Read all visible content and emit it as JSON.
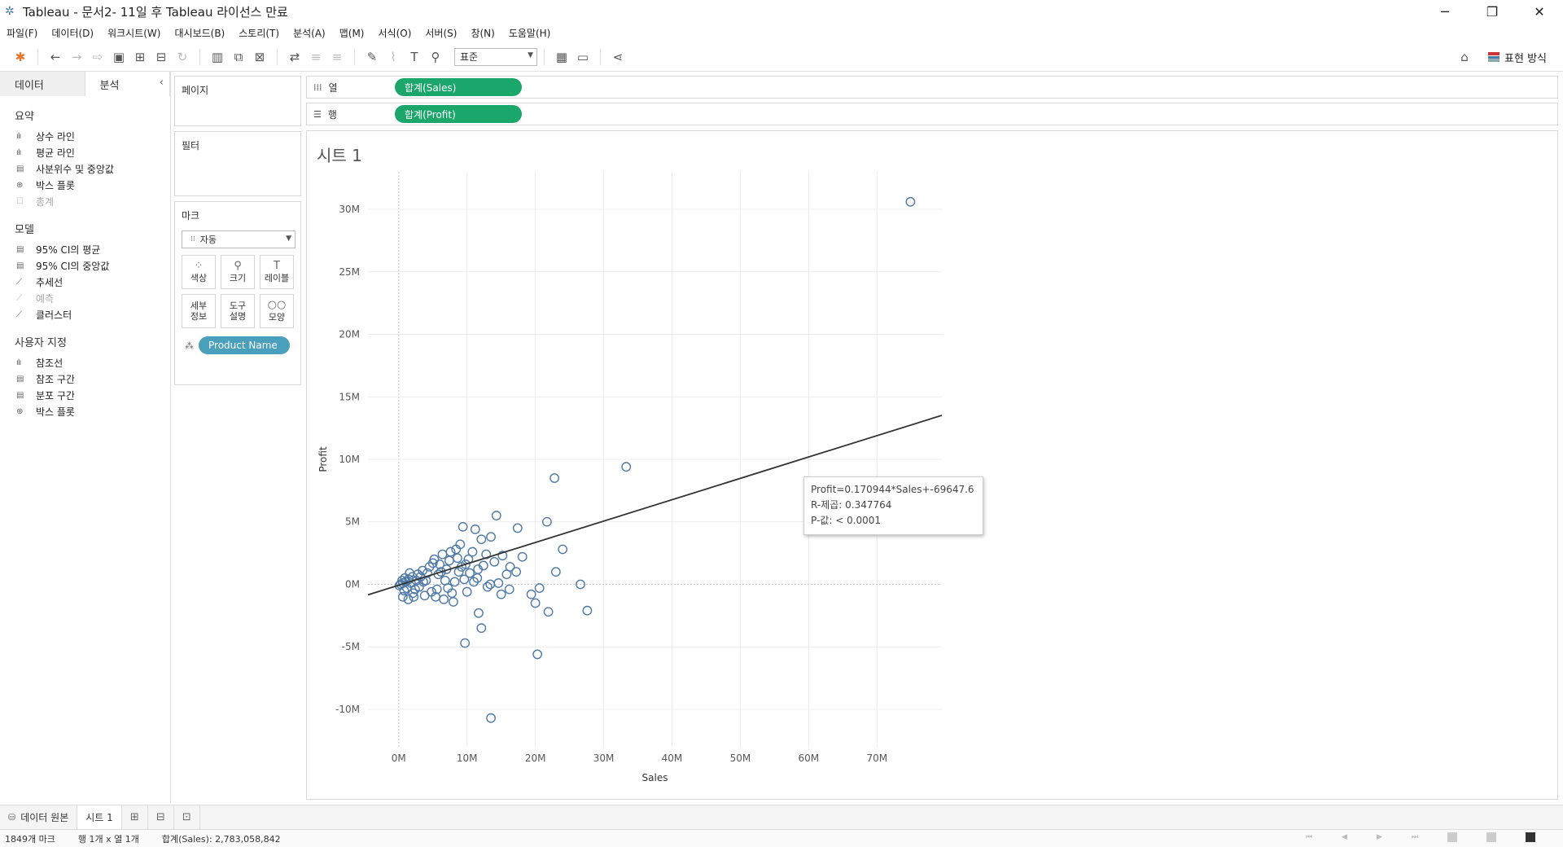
{
  "window": {
    "title": "Tableau - 문서2- 11일 후 Tableau 라이선스 만료",
    "minimize": "─",
    "restore": "❐",
    "close": "✕"
  },
  "menu": [
    "파일(F)",
    "데이터(D)",
    "워크시트(W)",
    "대시보드(B)",
    "스토리(T)",
    "분석(A)",
    "맵(M)",
    "서식(O)",
    "서버(S)",
    "창(N)",
    "도움말(H)"
  ],
  "toolbar": {
    "fit_select": "표준",
    "show_me_label": "표현 방식"
  },
  "left_pane": {
    "tabs": [
      "데이터",
      "분석"
    ],
    "sections": [
      {
        "title": "요약",
        "items": [
          {
            "label": "상수 라인",
            "icon": "lines-icon",
            "glyph": "ılı",
            "dim": false
          },
          {
            "label": "평균 라인",
            "icon": "lines-icon",
            "glyph": "ılı",
            "dim": false
          },
          {
            "label": "사분위수 및 중앙값",
            "icon": "band-icon",
            "glyph": "▤",
            "dim": false
          },
          {
            "label": "박스 플롯",
            "icon": "box-plot-icon",
            "glyph": "⊕",
            "dim": false
          },
          {
            "label": "총계",
            "icon": "total-icon",
            "glyph": "☐",
            "dim": true
          }
        ]
      },
      {
        "title": "모델",
        "items": [
          {
            "label": "95% CI의 평균",
            "icon": "band-icon",
            "glyph": "▤",
            "dim": false
          },
          {
            "label": "95% CI의 중앙값",
            "icon": "band-icon",
            "glyph": "▤",
            "dim": false
          },
          {
            "label": "추세선",
            "icon": "trend-line-icon",
            "glyph": "⟋",
            "dim": false
          },
          {
            "label": "예측",
            "icon": "forecast-icon",
            "glyph": "⟋",
            "dim": true
          },
          {
            "label": "클러스터",
            "icon": "cluster-icon",
            "glyph": "⟋",
            "dim": false
          }
        ]
      },
      {
        "title": "사용자 지정",
        "items": [
          {
            "label": "참조선",
            "icon": "lines-icon",
            "glyph": "ılı",
            "dim": false
          },
          {
            "label": "참조 구간",
            "icon": "band-icon",
            "glyph": "▤",
            "dim": false
          },
          {
            "label": "분포 구간",
            "icon": "band-icon",
            "glyph": "▤",
            "dim": false
          },
          {
            "label": "박스 플롯",
            "icon": "box-plot-icon",
            "glyph": "⊕",
            "dim": false
          }
        ]
      }
    ]
  },
  "cards": {
    "pages": "페이지",
    "filters": "필터",
    "marks": "마크",
    "mark_type": "자동",
    "mark_buttons": [
      {
        "label": "색상",
        "icon": "color-icon",
        "glyph": "⁘"
      },
      {
        "label": "크기",
        "icon": "size-icon",
        "glyph": "⚲"
      },
      {
        "label": "레이블",
        "icon": "label-icon",
        "glyph": "T"
      },
      {
        "label": "세부\n정보",
        "icon": "detail-icon",
        "glyph": ""
      },
      {
        "label": "도구\n설명",
        "icon": "tooltip-icon",
        "glyph": ""
      },
      {
        "label": "모양",
        "icon": "shape-icon",
        "glyph": "○○"
      }
    ],
    "detail_pill": "Product Name"
  },
  "shelves": {
    "columns_label": "열",
    "columns_pill": "합계(Sales)",
    "rows_label": "행",
    "rows_pill": "합계(Profit)"
  },
  "sheet_title": "시트 1",
  "trend_annotation": {
    "line1": "Profit=0.170944*Sales+-69647.6",
    "line2": "R-제곱: 0.347764",
    "line3": "P-값: < 0.0001"
  },
  "chart_data": {
    "type": "scatter",
    "xlabel": "Sales",
    "ylabel": "Profit",
    "x_ticks": [
      "0M",
      "10M",
      "20M",
      "30M",
      "40M",
      "50M",
      "60M",
      "70M"
    ],
    "y_ticks": [
      "30M",
      "25M",
      "20M",
      "15M",
      "10M",
      "5M",
      "0M",
      "-5M",
      "-10M"
    ],
    "xlim": [
      -4500000,
      79500000
    ],
    "ylim": [
      -13000000,
      33000000
    ],
    "grid": true,
    "marker": "hollow-circle",
    "marker_color": "#4e79a7",
    "trend_line": {
      "slope": 0.170944,
      "intercept": -69647.6,
      "x_range": [
        -4500000,
        79500000
      ],
      "color": "#333333"
    },
    "points": [
      [
        74900000,
        30600000
      ],
      [
        33300000,
        9400000
      ],
      [
        22800000,
        8500000
      ],
      [
        21700000,
        5000000
      ],
      [
        17400000,
        4500000
      ],
      [
        14300000,
        5500000
      ],
      [
        9400000,
        4600000
      ],
      [
        11200000,
        4400000
      ],
      [
        13500000,
        3800000
      ],
      [
        12100000,
        3600000
      ],
      [
        24000000,
        2800000
      ],
      [
        18100000,
        2200000
      ],
      [
        16300000,
        1400000
      ],
      [
        23000000,
        1000000
      ],
      [
        26600000,
        0
      ],
      [
        20600000,
        -300000
      ],
      [
        19400000,
        -800000
      ],
      [
        16200000,
        -400000
      ],
      [
        20000000,
        -1500000
      ],
      [
        21900000,
        -2200000
      ],
      [
        27600000,
        -2100000
      ],
      [
        11700000,
        -2300000
      ],
      [
        12100000,
        -3500000
      ],
      [
        9700000,
        -4700000
      ],
      [
        20300000,
        -5600000
      ],
      [
        13500000,
        -10700000
      ],
      [
        13400000,
        0
      ],
      [
        11500000,
        500000
      ],
      [
        10200000,
        2000000
      ],
      [
        9800000,
        1600000
      ],
      [
        8800000,
        1000000
      ],
      [
        8200000,
        200000
      ],
      [
        7800000,
        -700000
      ],
      [
        6600000,
        -1200000
      ],
      [
        5400000,
        -1000000
      ],
      [
        3800000,
        -900000
      ],
      [
        2200000,
        -1000000
      ],
      [
        1400000,
        -1200000
      ],
      [
        600000,
        -1000000
      ],
      [
        14000000,
        1800000
      ],
      [
        12800000,
        2400000
      ],
      [
        9000000,
        3200000
      ],
      [
        7600000,
        2600000
      ],
      [
        6400000,
        2400000
      ],
      [
        5200000,
        2000000
      ],
      [
        8400000,
        2800000
      ],
      [
        10800000,
        2600000
      ],
      [
        11600000,
        1200000
      ],
      [
        9600000,
        400000
      ],
      [
        8000000,
        -1400000
      ],
      [
        6000000,
        1600000
      ],
      [
        4500000,
        1400000
      ],
      [
        3500000,
        1100000
      ],
      [
        2800000,
        800000
      ],
      [
        2000000,
        600000
      ],
      [
        1500000,
        400000
      ],
      [
        1000000,
        200000
      ],
      [
        600000,
        100000
      ],
      [
        300000,
        0
      ],
      [
        100000,
        -100000
      ],
      [
        4000000,
        300000
      ],
      [
        3000000,
        -200000
      ],
      [
        2400000,
        -400000
      ],
      [
        1800000,
        100000
      ],
      [
        5800000,
        800000
      ],
      [
        7000000,
        1200000
      ],
      [
        6800000,
        300000
      ],
      [
        5600000,
        -400000
      ],
      [
        4800000,
        -600000
      ],
      [
        4200000,
        900000
      ],
      [
        3200000,
        600000
      ],
      [
        2600000,
        300000
      ],
      [
        1200000,
        -300000
      ],
      [
        800000,
        -500000
      ],
      [
        500000,
        300000
      ],
      [
        7400000,
        1900000
      ],
      [
        9200000,
        1400000
      ],
      [
        10400000,
        900000
      ],
      [
        12400000,
        1500000
      ],
      [
        15200000,
        2300000
      ],
      [
        15800000,
        800000
      ],
      [
        13000000,
        -200000
      ],
      [
        10000000,
        -600000
      ],
      [
        8600000,
        2100000
      ],
      [
        6200000,
        1000000
      ],
      [
        5000000,
        1700000
      ],
      [
        3600000,
        200000
      ],
      [
        2100000,
        -700000
      ],
      [
        1600000,
        900000
      ],
      [
        900000,
        500000
      ],
      [
        17200000,
        1000000
      ],
      [
        15000000,
        -800000
      ],
      [
        14600000,
        100000
      ],
      [
        11000000,
        200000
      ],
      [
        7200000,
        -300000
      ]
    ]
  },
  "sheet_tabs": {
    "data_source": "데이터 원본",
    "sheet": "시트 1"
  },
  "status": {
    "marks": "1849개 마크",
    "rows_cols": "행 1개 x 열 1개",
    "sum": "합계(Sales): 2,783,058,842"
  }
}
